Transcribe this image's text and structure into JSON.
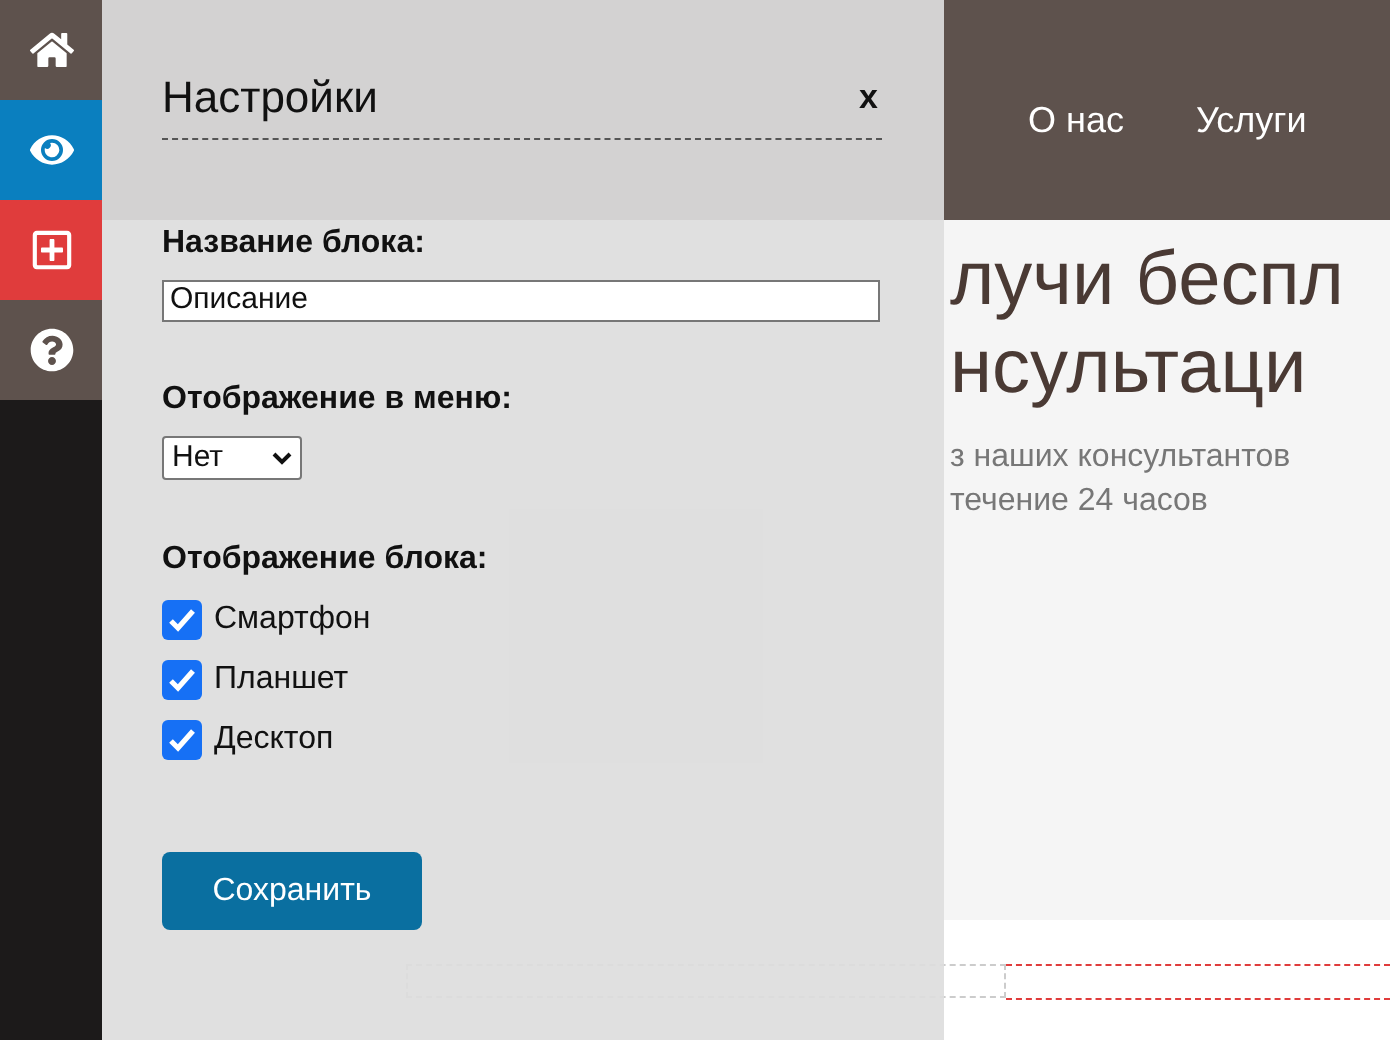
{
  "sidebar": {
    "items": [
      {
        "kind": "home",
        "color": "#5e524d"
      },
      {
        "kind": "eye",
        "color": "#0a7fbf"
      },
      {
        "kind": "plus",
        "color": "#e03c3c"
      },
      {
        "kind": "help",
        "color": "#5e524d"
      }
    ]
  },
  "site": {
    "nav": [
      "О нас",
      "Услуги"
    ],
    "hero_title": [
      "лучи беспл",
      "нсультаци"
    ],
    "hero_text": [
      "з наших консультантов",
      "течение 24 часов"
    ]
  },
  "settings": {
    "title": "Настройки",
    "close": "x",
    "name_label": "Название блока:",
    "name_value": "Описание",
    "menu_label": "Отображение в меню:",
    "menu_value": "Нет",
    "display_label": "Отображение блока:",
    "devices": [
      {
        "label": "Смартфон",
        "checked": true
      },
      {
        "label": "Планшет",
        "checked": true
      },
      {
        "label": "Десктоп",
        "checked": true
      }
    ],
    "save": "Сохранить"
  }
}
